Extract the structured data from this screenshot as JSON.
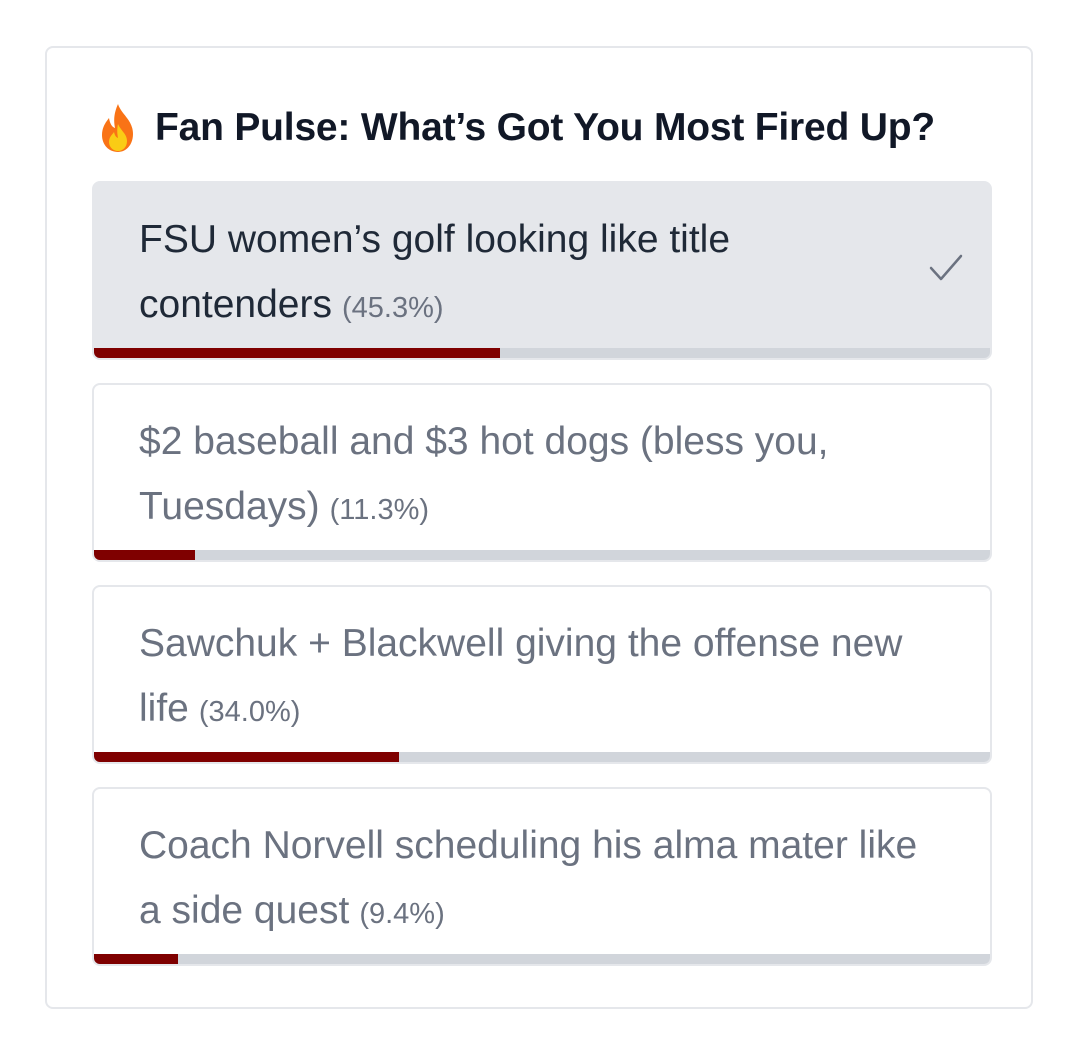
{
  "poll": {
    "title_emoji": "🔥",
    "title": "Fan Pulse: What’s Got You Most Fired Up?",
    "accent_color": "#7f0000",
    "options": [
      {
        "text": "FSU women’s golf looking like title contenders",
        "percent_label": "(45.3%)",
        "percent": 45.3,
        "selected": true
      },
      {
        "text": "$2 baseball and $3 hot dogs (bless you, Tuesdays)",
        "percent_label": "(11.3%)",
        "percent": 11.3,
        "selected": false
      },
      {
        "text": "Sawchuk + Blackwell giving the offense new life",
        "percent_label": "(34.0%)",
        "percent": 34.0,
        "selected": false
      },
      {
        "text": "Coach Norvell scheduling his alma mater like a side quest",
        "percent_label": "(9.4%)",
        "percent": 9.4,
        "selected": false
      }
    ],
    "icons": {
      "title": "fire-icon",
      "selected": "checkmark-icon"
    }
  }
}
